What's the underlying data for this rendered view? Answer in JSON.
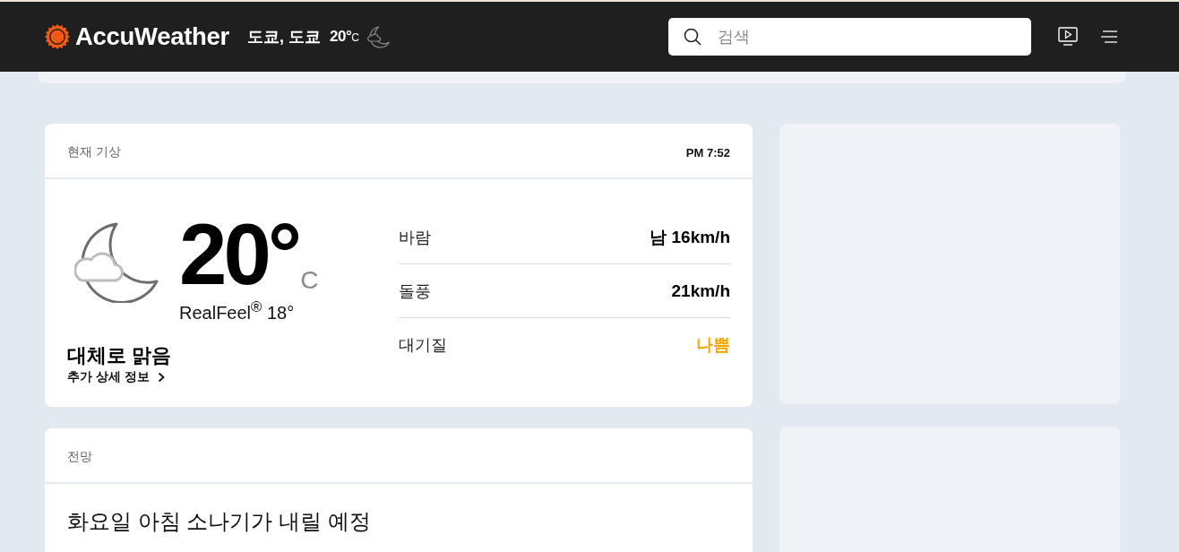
{
  "header": {
    "logo": "AccuWeather",
    "location": "도쿄, 도쿄",
    "temperature": "20°",
    "unit": "C",
    "search": {
      "placeholder": "검색"
    }
  },
  "current": {
    "title": "현재 기상",
    "time": "PM 7:52",
    "temperature": "20°",
    "unit": "C",
    "realfeel": "RealFeel$^{®}$ 18°",
    "condition": "대체로 맑음",
    "link": "추가 상세 정보",
    "details": [
      {
        "label": "바람",
        "value": "남 16km/h",
        "color": "#000000"
      },
      {
        "label": "돌풍",
        "value": "21km/h",
        "color": "#000000"
      },
      {
        "label": "대기질",
        "value": "나쁨",
        "color": "#f5a700"
      }
    ]
  },
  "forecast": {
    "title": "전망",
    "headline": "화요일 아침 소나기가 내릴 예정"
  }
}
